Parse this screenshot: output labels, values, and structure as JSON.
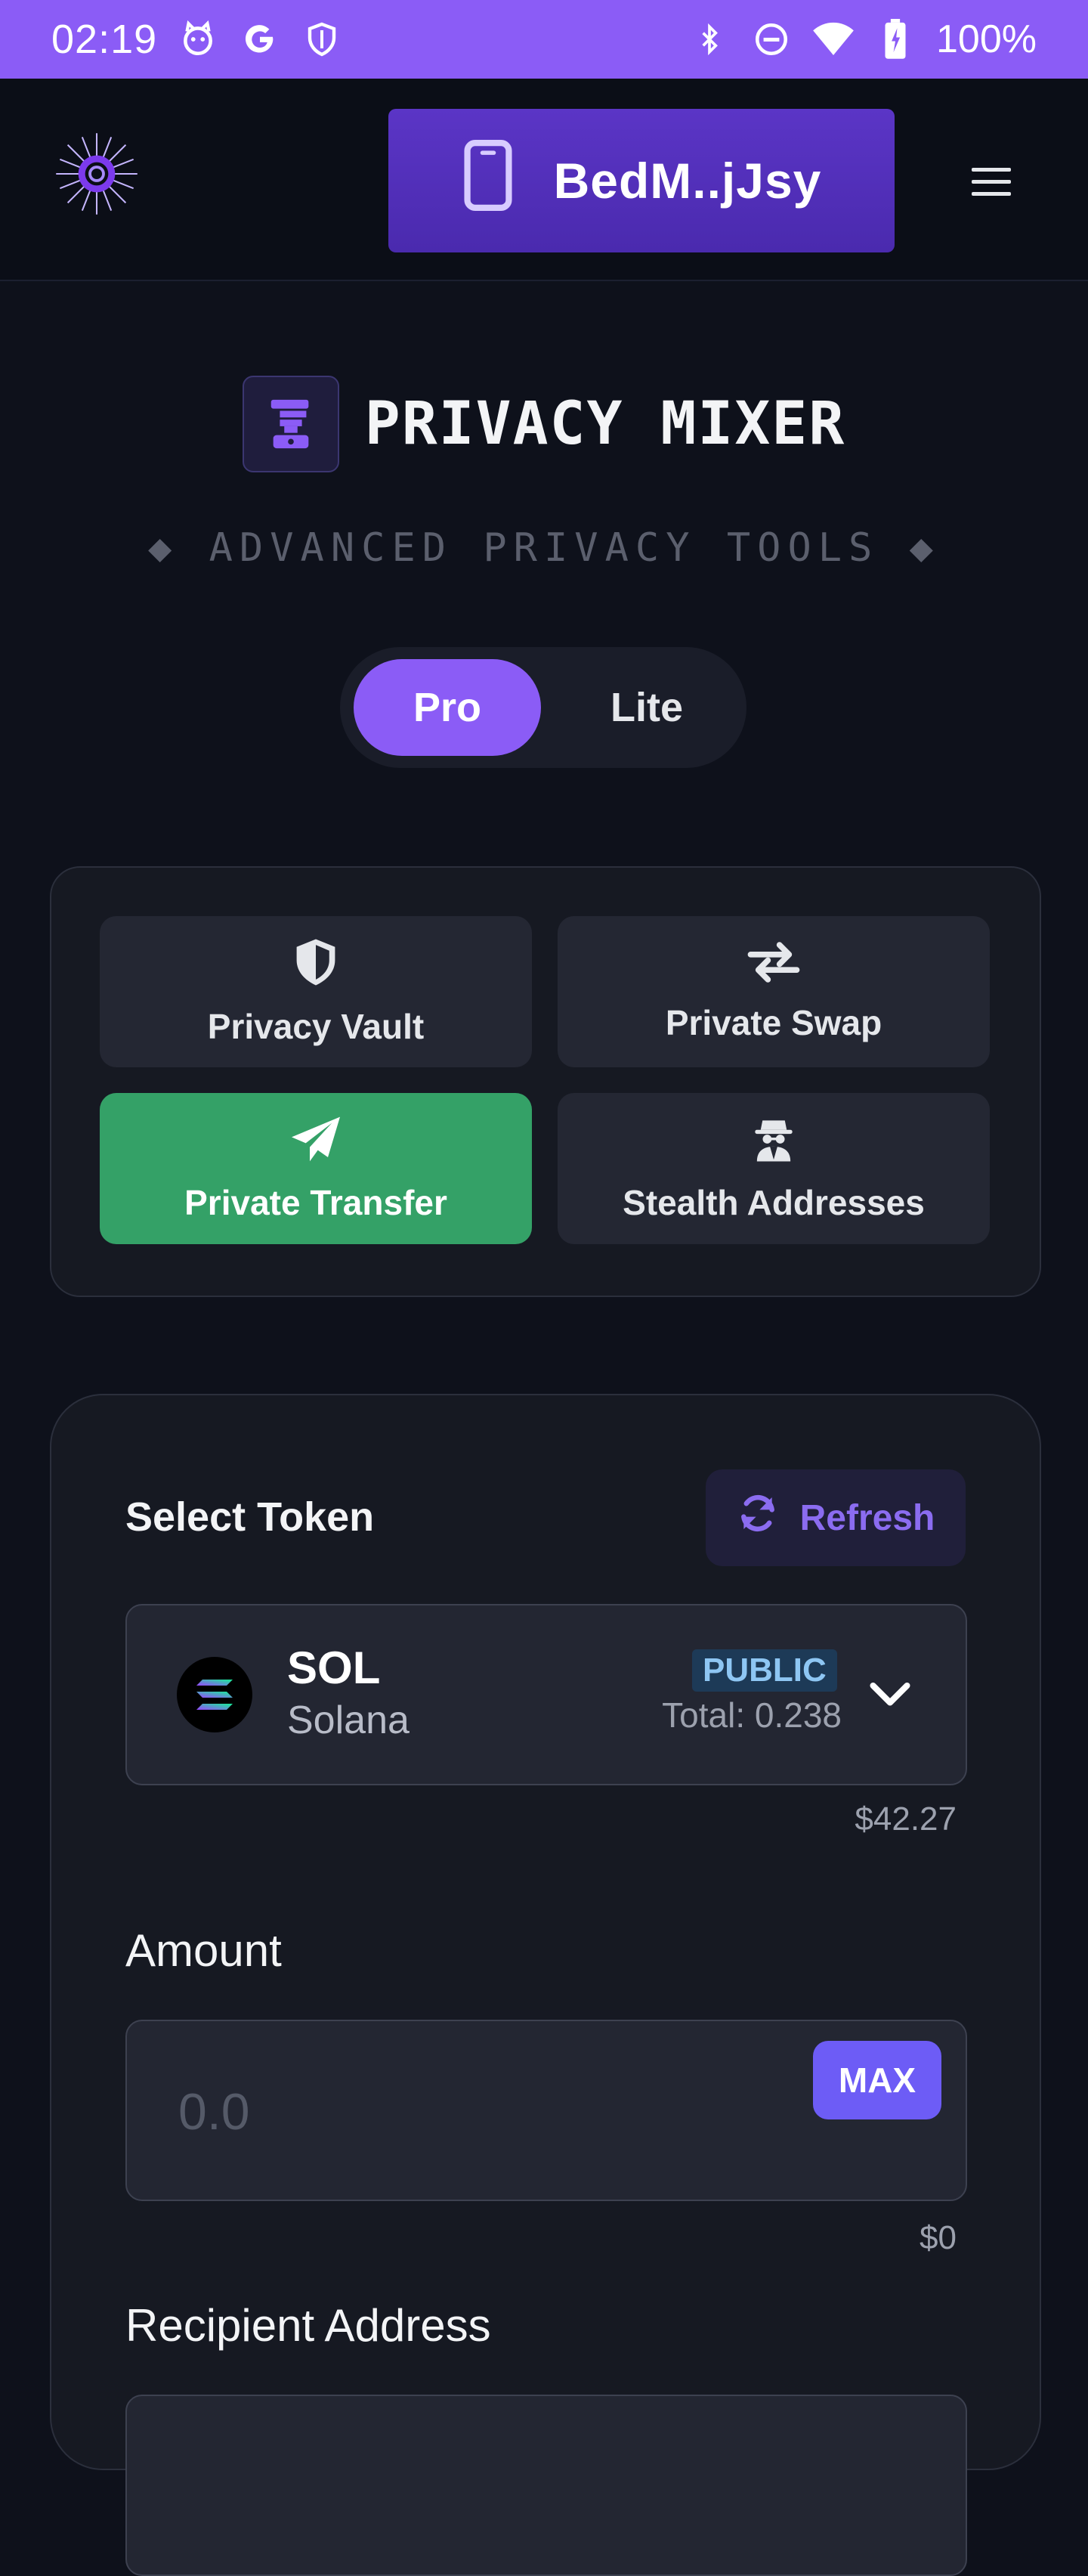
{
  "status_bar": {
    "time": "02:19",
    "left_icons": [
      "cat-face-icon",
      "google-g-icon",
      "shield-icon"
    ],
    "right_icons": [
      "bluetooth-icon",
      "do-not-disturb-icon",
      "wifi-icon",
      "battery-icon"
    ],
    "battery": "100%"
  },
  "header": {
    "logo_icon": "spiky-orb-logo-icon",
    "wallet_label": "BedM..jJsy",
    "wallet_icon": "phone-icon",
    "menu_icon": "hamburger-menu-icon"
  },
  "title": {
    "icon": "mixer-blender-icon",
    "text": "PRIVACY MIXER",
    "subtitle": "◆ ADVANCED PRIVACY TOOLS ◆"
  },
  "mode_toggle": {
    "options": [
      "Pro",
      "Lite"
    ],
    "selected": "Pro"
  },
  "features": [
    {
      "label": "Privacy Vault",
      "icon": "shield-icon",
      "active": false
    },
    {
      "label": "Private Swap",
      "icon": "swap-arrows-icon",
      "active": false
    },
    {
      "label": "Private Transfer",
      "icon": "paper-plane-icon",
      "active": true
    },
    {
      "label": "Stealth Addresses",
      "icon": "spy-icon",
      "active": false
    }
  ],
  "form": {
    "select_token_label": "Select Token",
    "refresh_label": "Refresh",
    "token": {
      "symbol": "SOL",
      "name": "Solana",
      "badge": "PUBLIC",
      "total": "Total: 0.238",
      "usd_value": "$42.27"
    },
    "amount_label": "Amount",
    "amount_placeholder": "0.0",
    "max_label": "MAX",
    "amount_usd": "$0",
    "recipient_label": "Recipient Address"
  },
  "colors": {
    "accent": "#8b5cf6",
    "active_feature": "#34a167",
    "background": "#0e111b"
  }
}
